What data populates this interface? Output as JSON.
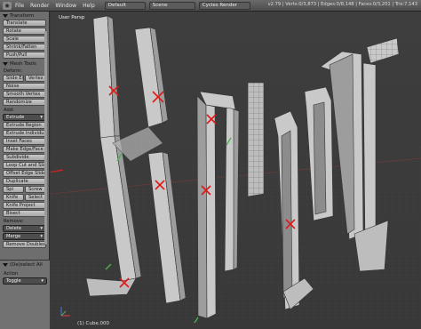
{
  "header": {
    "menu": [
      "File",
      "Render",
      "Window",
      "Help"
    ],
    "layout": "Default",
    "scene": "Scene",
    "engine": "Cycles Render",
    "stats": "v2.79 | Verts:0/3,873 | Edges:0/8,148 | Faces:0/3,201 | Tris:7,143"
  },
  "toolshelf": {
    "transform_header": "Transform",
    "transform_buttons": [
      "Translate",
      "Rotate",
      "Scale",
      "Shrink/Fatten",
      "Push/Pull"
    ],
    "mesh_tools_header": "Mesh Tools",
    "deform_label": "Deform:",
    "slide_edge": "Slide Ed",
    "vertex": "Vertex",
    "noise": "Noise",
    "smooth_vertex": "Smooth Vertex",
    "randomize": "Randomize",
    "add_label": "Add:",
    "extrude_select": "Extrude",
    "add_buttons": [
      "Extrude Region",
      "Extrude Individual",
      "Inset Faces",
      "Make Edge/Face",
      "Subdivide",
      "Loop Cut and Slide",
      "Offset Edge Slide",
      "Duplicate"
    ],
    "spin": "Spi",
    "screw": "Screw",
    "knife": "Knife",
    "select": "Select",
    "knife_project": "Knife Project",
    "bisect": "Bisect",
    "remove_label": "Remove:",
    "delete_select": "Delete",
    "merge_select": "Merge",
    "remove_doubles": "Remove Doubles",
    "deselect_all": "(De)select All",
    "action_label": "Action",
    "toggle_select": "Toggle"
  },
  "viewport": {
    "label": "User Persp",
    "object": "(1) Cube.000"
  },
  "colors": {
    "mesh_face": "#c9c9c9",
    "mesh_side": "#9d9d9d",
    "x_mark": "#e01818",
    "arrow": "#cc2222",
    "axis_x": "#e04040",
    "axis_y": "#4caf50",
    "axis_z": "#4a7ae0"
  }
}
